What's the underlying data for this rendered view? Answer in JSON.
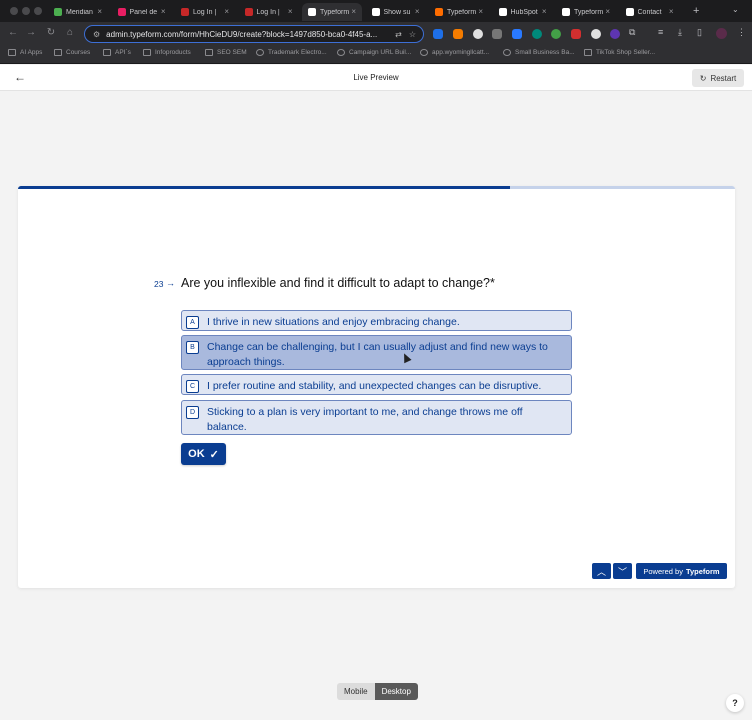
{
  "browser": {
    "tabs": [
      {
        "title": "Meridian",
        "color": "#4caf50"
      },
      {
        "title": "Panel de",
        "color": "#e91e63"
      },
      {
        "title": "Log In |",
        "color": "#c62828"
      },
      {
        "title": "Log In |",
        "color": "#c62828"
      },
      {
        "title": "Typeform",
        "color": "#ffffff",
        "active": true
      },
      {
        "title": "Show su",
        "color": "#ffffff"
      },
      {
        "title": "Typeform",
        "color": "#ff6d00"
      },
      {
        "title": "HubSpot",
        "color": "#ffffff"
      },
      {
        "title": "Typeform",
        "color": "#ffffff"
      },
      {
        "title": "Contact",
        "color": "#ffffff"
      }
    ],
    "url": "admin.typeform.com/form/HhCieDU9/create?block=1497d850-bca0-4f45-a...",
    "bookmarks": [
      {
        "label": "AI Apps"
      },
      {
        "label": "Courses"
      },
      {
        "label": "API´s"
      },
      {
        "label": "Infoproducts"
      },
      {
        "label": "SEO SEM"
      },
      {
        "label": "Trademark Electro..."
      },
      {
        "label": "Campaign URL Buil..."
      },
      {
        "label": "app.wyomingllcatt..."
      },
      {
        "label": "Small Business Ba..."
      },
      {
        "label": "TikTok Shop Seller..."
      }
    ]
  },
  "preview": {
    "title": "Live Preview",
    "restart_label": "Restart"
  },
  "form": {
    "progress": 0.686,
    "question_number": "23",
    "question_text": "Are you inflexible and find it difficult to adapt to change?*",
    "choices": [
      {
        "key": "A",
        "text": "I thrive in new situations and enjoy embracing change.",
        "selected": false
      },
      {
        "key": "B",
        "text": "Change can be challenging, but I can usually adjust and find new ways to approach things.",
        "selected": true
      },
      {
        "key": "C",
        "text": "I prefer routine and stability, and unexpected changes can be disruptive.",
        "selected": false
      },
      {
        "key": "D",
        "text": "Sticking to a plan is very important to me, and change throws me off balance.",
        "selected": false
      }
    ],
    "ok_label": "OK",
    "powered_prefix": "Powered by",
    "powered_brand": "Typeform"
  },
  "device_toggle": {
    "mobile_label": "Mobile",
    "desktop_label": "Desktop",
    "active": "Desktop"
  },
  "help_label": "?",
  "colors": {
    "accent": "#0a3d91",
    "choice_bg": "#e0e6f3",
    "choice_selected_bg": "#a9b9dd"
  }
}
